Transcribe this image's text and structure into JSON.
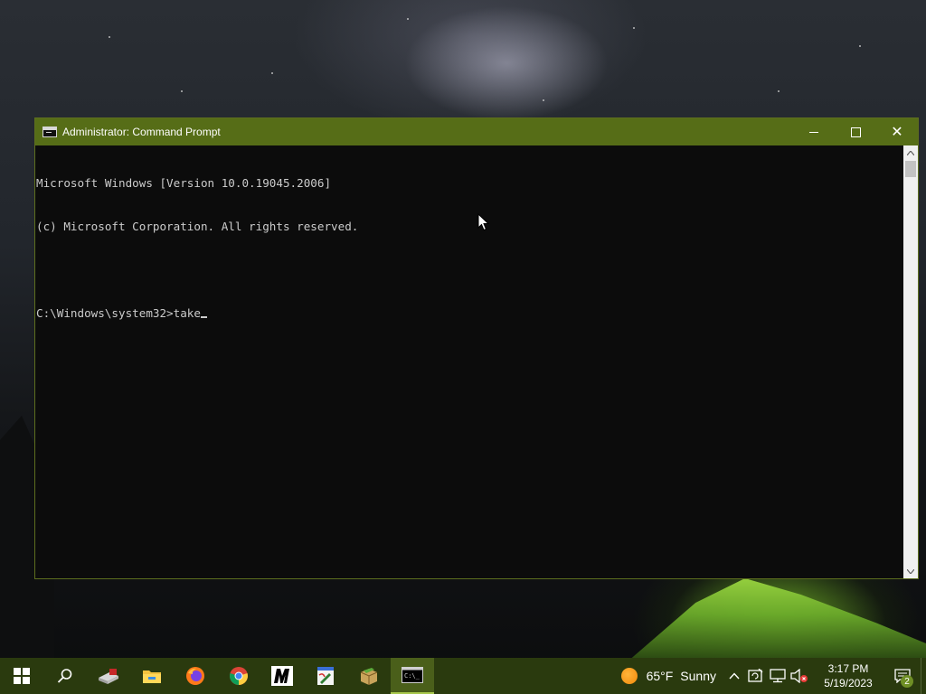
{
  "window": {
    "title": "Administrator: Command Prompt",
    "controls": {
      "minimize_icon": "minimize-icon",
      "maximize_icon": "maximize-icon",
      "close_icon": "close-icon"
    }
  },
  "console": {
    "lines": [
      "Microsoft Windows [Version 10.0.19045.2006]",
      "(c) Microsoft Corporation. All rights reserved.",
      "",
      "C:\\Windows\\system32>take"
    ]
  },
  "taskbar": {
    "apps": [
      {
        "name": "start-button",
        "icon": "windows-logo-icon"
      },
      {
        "name": "search-button",
        "icon": "search-icon"
      },
      {
        "name": "taskbar-app-rescue-disk",
        "icon": "disk-tool-icon"
      },
      {
        "name": "taskbar-app-file-explorer",
        "icon": "folder-icon"
      },
      {
        "name": "taskbar-app-firefox",
        "icon": "firefox-icon"
      },
      {
        "name": "taskbar-app-chrome",
        "icon": "chrome-icon"
      },
      {
        "name": "taskbar-app-m",
        "icon": "m-letter-icon"
      },
      {
        "name": "taskbar-app-paint",
        "icon": "paint-icon"
      },
      {
        "name": "taskbar-app-archive",
        "icon": "package-icon"
      },
      {
        "name": "taskbar-app-command-prompt",
        "icon": "cmd-icon"
      }
    ],
    "weather": {
      "temp": "65°F",
      "condition": "Sunny"
    },
    "clock": {
      "time": "3:17 PM",
      "date": "5/19/2023"
    },
    "notifications": {
      "count": "2"
    }
  },
  "colors": {
    "titlebar": "#566d17",
    "taskbar": "#2a3a0e",
    "console_bg": "#0c0c0c",
    "console_fg": "#cccccc"
  }
}
